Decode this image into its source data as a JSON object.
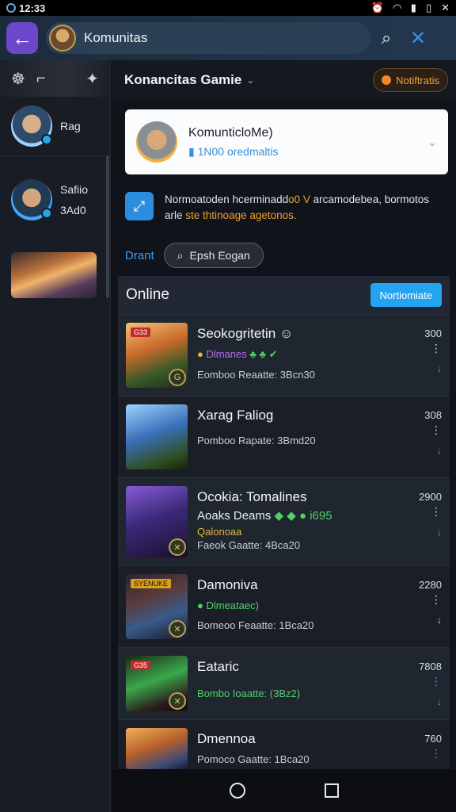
{
  "status": {
    "time": "12:33"
  },
  "appbar": {
    "title": "Komunitas"
  },
  "sidebar": {
    "contacts": [
      {
        "name": "Rag"
      },
      {
        "name": "Safiio",
        "sub": "3Ad0"
      }
    ]
  },
  "main": {
    "header_title": "Konancitas Gamie",
    "notif_label": "Notiftratis",
    "card": {
      "line1": "KomunticloMe)",
      "line2": "1N00 oredmaltis"
    },
    "info": {
      "text_a": "Normoatoden hcerminadd",
      "text_hl1": "o0 V",
      "text_b": "arcamodebea, bormotos arle",
      "text_hl2": "ste thtinoage agetonos."
    },
    "filter_link": "Drant",
    "filter_pill": "Epsh Eogan",
    "section_title": "Online",
    "section_button": "Nortiomiate"
  },
  "rows": [
    {
      "title": "Seokogritetin",
      "sub": "Dlmanes",
      "meta": "Eomboo Reaatte: 3Bcn30",
      "num": "300",
      "tag": "G33"
    },
    {
      "title": "Xarag Faliog",
      "sub": "",
      "meta": "Pomboo Rapate: 3Bmd20",
      "num": "308",
      "tag": ""
    },
    {
      "title": "Ocokia: Tomalines",
      "sub": "Aoaks Deams",
      "sub_extra": "i695",
      "meta2": "Qalonoaa",
      "meta": "Faeok Gaatte: 4Bca20",
      "num": "2900",
      "tag": ""
    },
    {
      "title": "Damoniva",
      "sub": "Dlmeataec)",
      "meta": "Bomeoo Feaatte: 1Bca20",
      "num": "2280",
      "tag": "SYENUKE"
    },
    {
      "title": "Eataric",
      "sub": "Bombo Ioaatte: (3Bz2)",
      "meta": "",
      "num": "7808",
      "tag": "G35"
    },
    {
      "title": "Dmennoa",
      "sub": "",
      "meta": "Pomoco Gaatte: 1Bca20",
      "num": "760",
      "tag": ""
    }
  ]
}
